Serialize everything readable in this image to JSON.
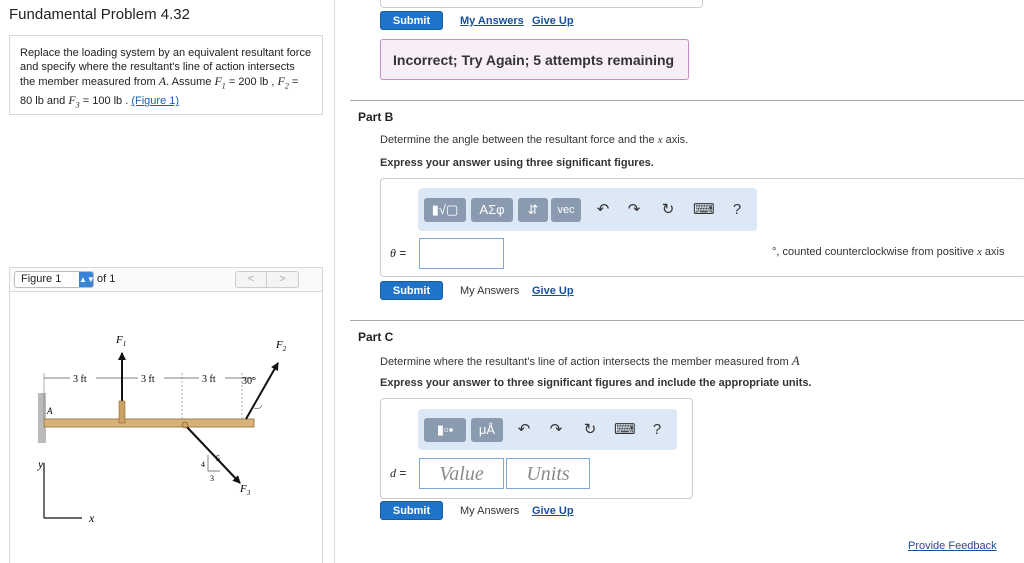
{
  "problem": {
    "title": "Fundamental Problem 4.32",
    "text_1": "Replace the loading system by an equivalent resultant force and specify where the resultant's line of action intersects the member measured from",
    "point_A": "A",
    "text_2": ". Assume",
    "F1": "F",
    "F1_sub": "1",
    "eq1": " = 200 lb ,",
    "F2": "F",
    "F2_sub": "2",
    "eq2": " = 80 lb and",
    "F3": "F",
    "F3_sub": "3",
    "eq3": " = 100 lb .",
    "figure_link": "(Figure 1)"
  },
  "figure": {
    "select_value": "Figure 1",
    "of_label": "of 1",
    "prev": "<",
    "next": ">",
    "labels": {
      "F1": "F",
      "F1_sub": "1",
      "F2": "F",
      "F2_sub": "2",
      "F3": "F",
      "F3_sub": "3",
      "dist1": "3 ft",
      "dist2": "3 ft",
      "dist3": "3 ft",
      "angle": "30°",
      "point_A": "A",
      "y_axis": "y",
      "x_axis": "x",
      "tri_4": "4",
      "tri_5": "5",
      "tri_3": "3"
    }
  },
  "part_a_footer": {
    "submit": "Submit",
    "my_answers": "My Answers",
    "give_up": "Give Up",
    "feedback": "Incorrect; Try Again; 5 attempts remaining"
  },
  "part_b": {
    "label": "Part B",
    "instruction_1": "Determine the angle between the resultant force and the",
    "x_var": "x",
    "instruction_1_end": "axis.",
    "instruction_2": "Express your answer using three significant figures.",
    "toolbar": {
      "templates": "▮√▢",
      "greek": "ΑΣφ",
      "arrows": "⇵",
      "vec": "vec",
      "undo": "↶",
      "redo": "↷",
      "reset": "↻",
      "keyboard": "⌨",
      "help": "?"
    },
    "theta": "θ",
    "equals": "=",
    "unit_text": "°, counted counterclockwise from positive",
    "unit_var": "x",
    "unit_end": "axis",
    "submit": "Submit",
    "my_answers": "My Answers",
    "give_up": "Give Up"
  },
  "part_c": {
    "label": "Part C",
    "instruction_1": "Determine where the resultant's line of action intersects the member measured from",
    "point_A": "A",
    "instruction_2": "Express your answer to three significant figures and include the appropriate units.",
    "toolbar": {
      "templates": "▮▫▪",
      "units": "μÅ",
      "undo": "↶",
      "redo": "↷",
      "reset": "↻",
      "keyboard": "⌨",
      "help": "?"
    },
    "d_var": "d",
    "equals": "=",
    "value_placeholder": "Value",
    "units_placeholder": "Units",
    "submit": "Submit",
    "my_answers": "My Answers",
    "give_up": "Give Up"
  },
  "provide_feedback": "Provide Feedback"
}
